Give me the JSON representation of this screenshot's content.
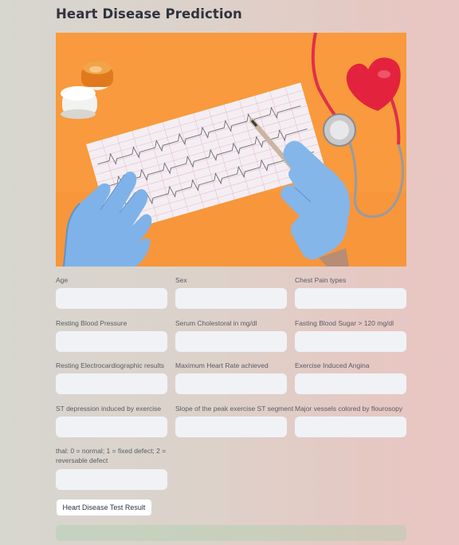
{
  "page": {
    "title": "Heart Disease Prediction"
  },
  "hero_image": {
    "description_icon": "heart-ecg-stethoscope-image"
  },
  "form": {
    "fields": [
      {
        "label": "Age",
        "value": ""
      },
      {
        "label": "Sex",
        "value": ""
      },
      {
        "label": "Chest Pain types",
        "value": ""
      },
      {
        "label": "Resting Blood Pressure",
        "value": ""
      },
      {
        "label": "Serum Cholestoral in mg/dl",
        "value": ""
      },
      {
        "label": "Fasting Blood Sugar > 120 mg/dl",
        "value": ""
      },
      {
        "label": "Resting Electrocardiographic results",
        "value": ""
      },
      {
        "label": "Maximum Heart Rate achieved",
        "value": ""
      },
      {
        "label": "Exercise Induced Angina",
        "value": ""
      },
      {
        "label": "ST depression induced by exercise",
        "value": ""
      },
      {
        "label": "Slope of the peak exercise ST segment",
        "value": ""
      },
      {
        "label": "Major vessels colored by flourosopy",
        "value": ""
      },
      {
        "label": "thal: 0 = normal; 1 = fixed defect; 2 = reversable defect",
        "value": ""
      }
    ],
    "submit_label": "Heart Disease Test Result"
  },
  "result": {
    "text": ""
  },
  "colors": {
    "input_bg": "#f0f2f6",
    "hero_bg": "#f89a3d",
    "result_bg": "#a0cda5"
  }
}
